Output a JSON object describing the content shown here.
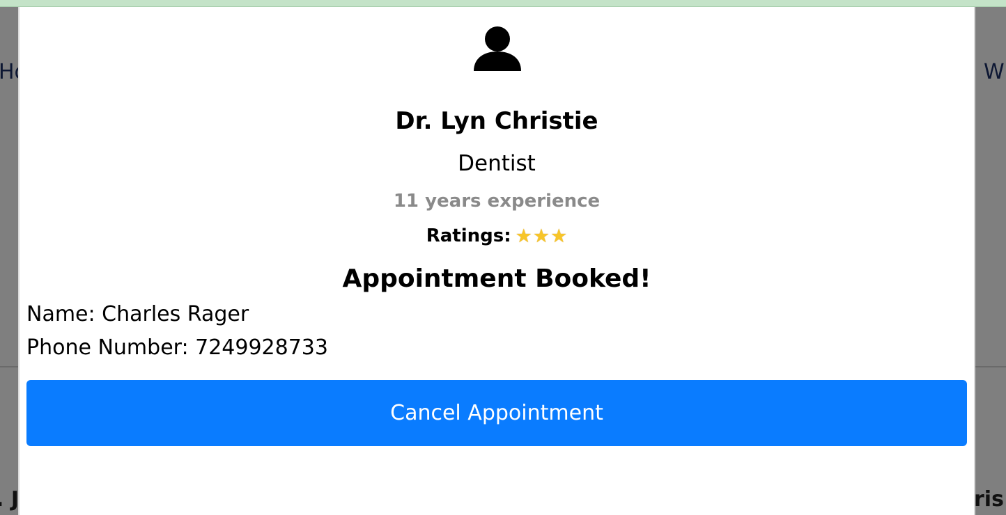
{
  "background": {
    "left_partial_top": "Ho",
    "right_partial_top": "W",
    "left_partial_bottom": ". J",
    "right_partial_bottom": "ris"
  },
  "modal": {
    "doctor": {
      "avatar_icon": "user-icon",
      "name": "Dr. Lyn Christie",
      "specialty": "Dentist",
      "experience": "11 years experience",
      "ratings_label": "Ratings:",
      "rating_stars": 3,
      "star_glyph": "⭐"
    },
    "booking": {
      "title": "Appointment Booked!",
      "name_label": "Name:",
      "name_value": "Charles Rager",
      "phone_label": "Phone Number:",
      "phone_value": "7249928733"
    },
    "cancel_button_label": "Cancel Appointment"
  },
  "colors": {
    "primary_button": "#0a7cff",
    "experience_text": "#8a8a8a",
    "overlay": "#7f7f7f",
    "top_strip": "#c4e3c8"
  }
}
